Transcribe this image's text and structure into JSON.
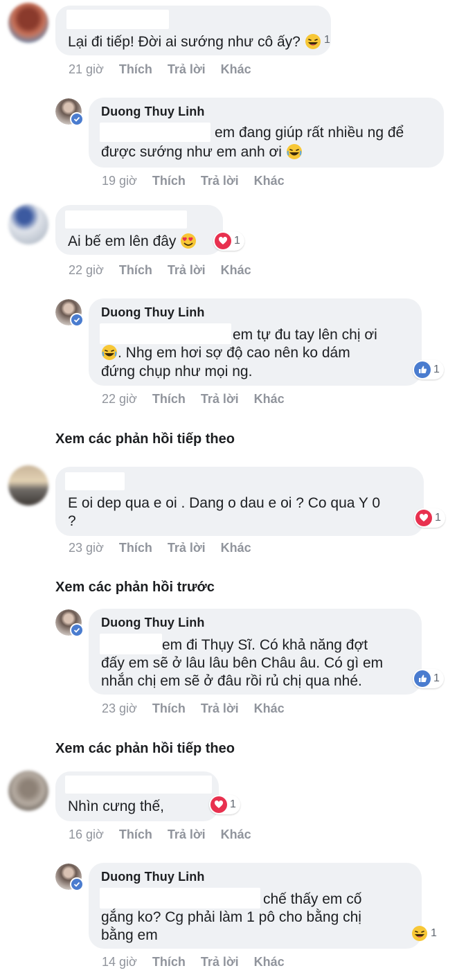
{
  "thread": {
    "c1": {
      "text": "Lại đi tiếp! Đời ai sướng như cô ấy?",
      "reaction_count": "1",
      "time": "21 giờ"
    },
    "r1": {
      "author": "Duong Thuy Linh",
      "line1": "em đang giúp rất nhiều ng để",
      "line2": "được sướng như em anh ơi",
      "time": "19 giờ"
    },
    "c2": {
      "text": "Ai bế em lên đây",
      "reaction_count": "1",
      "time": "22 giờ"
    },
    "r2": {
      "author": "Duong Thuy Linh",
      "line1": "em tự đu tay lên chị ơi",
      "line2": ". Nhg em hơi sợ độ cao nên ko dám",
      "line3": "đứng chụp như mọi ng.",
      "reaction_count": "1",
      "time": "22 giờ"
    },
    "more1": "Xem các phản hồi tiếp theo",
    "c3": {
      "line1": "E oi dep qua e oi . Dang o dau e oi ? Co qua Y 0",
      "line2": "?",
      "reaction_count": "1",
      "time": "23 giờ"
    },
    "prev": "Xem các phản hồi trước",
    "r3": {
      "author": "Duong Thuy Linh",
      "line1": "em đi Thụy Sĩ. Có khả năng đợt",
      "line2": "đấy em sẽ ở lâu lâu bên Châu âu. Có gì em",
      "line3": "nhắn chị em sẽ ở đâu rồi rủ chị qua nhé.",
      "reaction_count": "1",
      "time": "23 giờ"
    },
    "more2": "Xem các phản hồi tiếp theo",
    "c4": {
      "text": "Nhìn cưng thế,",
      "reaction_count": "1",
      "time": "16 giờ"
    },
    "r4": {
      "author": "Duong Thuy Linh",
      "line1": "chế thấy em cố",
      "line2": "gắng ko? Cg phải làm 1 pô cho bằng chị",
      "line3": "bằng em",
      "reaction_count": "1",
      "time": "14 giờ"
    }
  },
  "actions": {
    "like": "Thích",
    "reply": "Trả lời",
    "more": "Khác"
  },
  "colors": {
    "bubble": "#eff1f4",
    "meta": "#90949c",
    "like_blue": "#4a7ccf",
    "love_red": "#e8314f",
    "haha_yellow": "#f7c736"
  },
  "icons": {
    "haha": "haha-emoji-icon",
    "heart_eyes": "heart-eyes-emoji-icon",
    "love": "love-reaction-icon",
    "like": "like-reaction-icon",
    "verified": "verified-badge-icon"
  }
}
